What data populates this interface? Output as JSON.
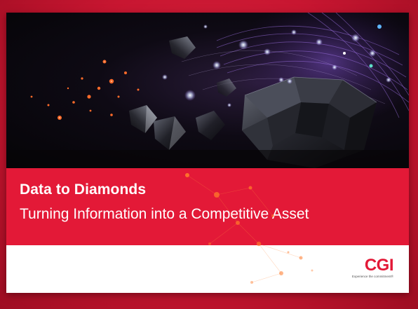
{
  "cover": {
    "title": "Data to Diamonds",
    "subtitle": "Turning Information into a Competitive Asset"
  },
  "logo": {
    "mark": "CGI",
    "tagline": "Experience the commitment®"
  },
  "colors": {
    "brand_red": "#e31937",
    "background_red": "#c81631",
    "hero_dark": "#0e0a14",
    "particle_orange": "#ff7a2a"
  },
  "icons": {
    "hero_image": "diamonds-network-image",
    "particles": "orange-particle-network"
  }
}
